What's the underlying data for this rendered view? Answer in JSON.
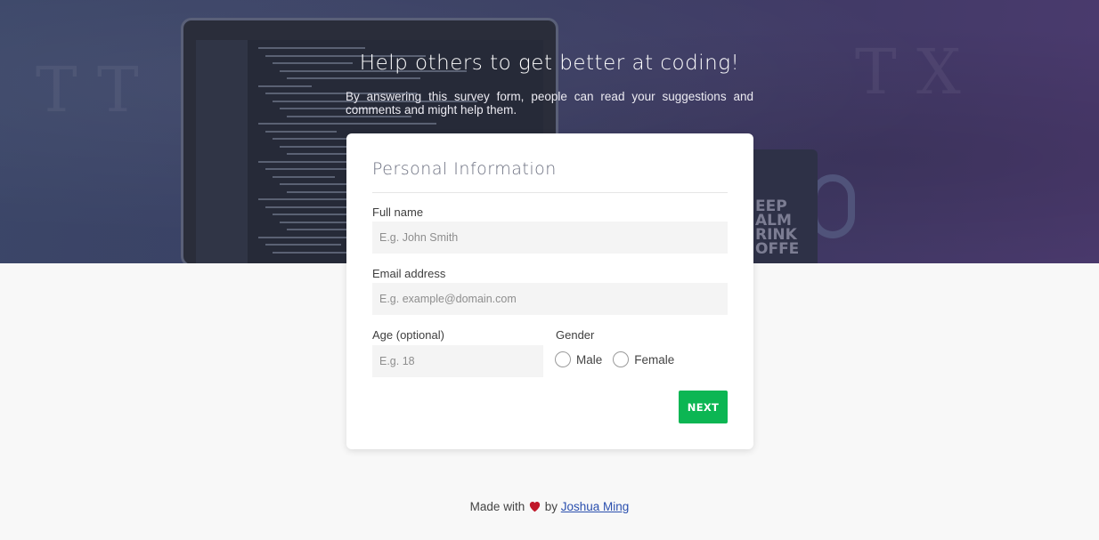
{
  "hero": {
    "title": "Help others to get better at coding!",
    "subtitle": "By answering this survey form, people can read your suggestions and comments and might help them."
  },
  "form": {
    "section_title": "Personal Information",
    "full_name": {
      "label": "Full name",
      "placeholder": "E.g. John Smith",
      "value": ""
    },
    "email": {
      "label": "Email address",
      "placeholder": "E.g. example@domain.com",
      "value": ""
    },
    "age": {
      "label": "Age (optional)",
      "placeholder": "E.g. 18",
      "value": ""
    },
    "gender": {
      "label": "Gender",
      "options": [
        {
          "label": "Male",
          "selected": false
        },
        {
          "label": "Female",
          "selected": false
        }
      ]
    },
    "next_label": "NEXT"
  },
  "footer": {
    "prefix": "Made with",
    "by": "by",
    "author": "Joshua Ming",
    "heart_icon": "heart-icon"
  },
  "colors": {
    "accent": "#0cb653",
    "link": "#2a4fae",
    "hero_overlay": "#3d4068",
    "heart": "#c0182a"
  }
}
